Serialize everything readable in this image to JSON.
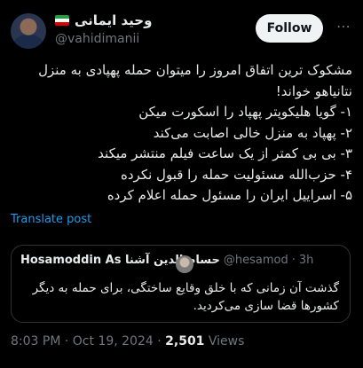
{
  "author": {
    "display_name": "وحید ایمانی",
    "handle": "@vahidimanii",
    "flag_colors": [
      "#239f40",
      "#ffffff",
      "#da0000"
    ]
  },
  "follow_label": "Follow",
  "tweet_lines": [
    "مشکوک ترین اتفاق امروز را میتوان حمله پهپادی به منزل",
    "نتانیاهو خواند!",
    "۱- گویا هلیکوپتر پهپاد را اسکورت میکن",
    "۲- پهپاد به منزل خالی اصابت می‌کند",
    "۳- بی بی کمتر از یک ساعت فیلم منتشر میکند",
    "۴- حزب‌الله مسئولیت حمله را قبول نکرده",
    "۵- اسراییل ایران را مسئول حمله اعلام کرده"
  ],
  "translate_label": "Translate post",
  "quote": {
    "name": "Hosamoddin As حسام الدین آشنا",
    "handle": "@hesamod",
    "separator": "·",
    "age": "3h",
    "text": "گذشت آن زمانی که با خلق وقایع ساختگی، برای حمله به دیگر کشورها قضا سازی می‌کردید."
  },
  "meta": {
    "time": "8:03 PM",
    "separator": "·",
    "date": "Oct 19, 2024",
    "views_count": "2,501",
    "views_label": "Views"
  }
}
